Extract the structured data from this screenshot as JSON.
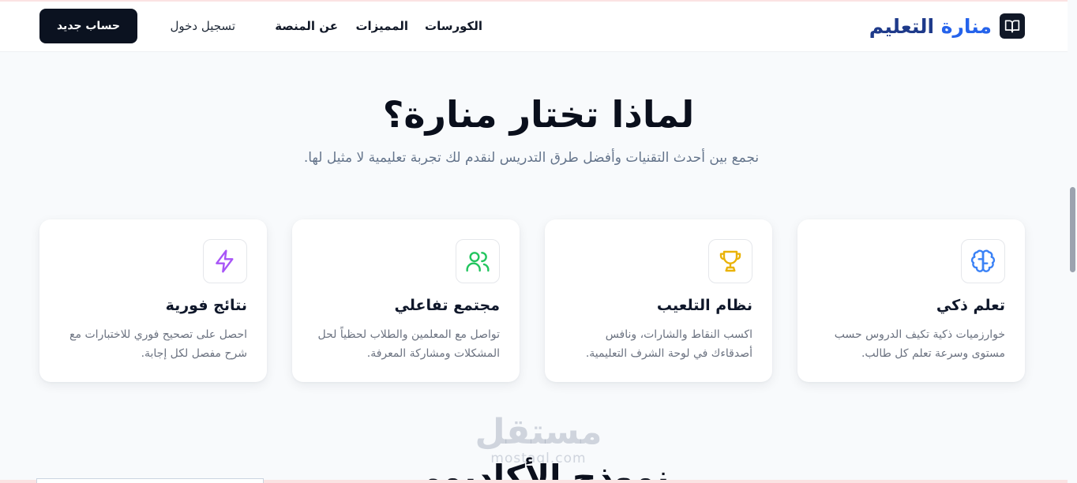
{
  "brand": {
    "name_part1": "منارة",
    "name_part2": "التعليم",
    "icon": "book-open-icon"
  },
  "nav": {
    "items": [
      {
        "label": "الكورسات"
      },
      {
        "label": "المميزات"
      },
      {
        "label": "عن المنصة"
      }
    ],
    "login_label": "تسجيل دخول",
    "signup_label": "حساب جديد"
  },
  "hero": {
    "title": "لماذا تختار منارة؟",
    "subtitle": "نجمع بين أحدث التقنيات وأفضل طرق التدريس لنقدم لك تجربة تعليمية لا مثيل لها."
  },
  "features": [
    {
      "icon": "brain-icon",
      "color": "#3b82f6",
      "title": "تعلم ذكي",
      "desc": "خوارزميات ذكية تكيف الدروس حسب مستوى وسرعة تعلم كل طالب."
    },
    {
      "icon": "trophy-icon",
      "color": "#eab308",
      "title": "نظام التلعيب",
      "desc": "اكسب النقاط والشارات، ونافس أصدقاءك في لوحة الشرف التعليمية."
    },
    {
      "icon": "users-icon",
      "color": "#22c55e",
      "title": "مجتمع تفاعلي",
      "desc": "تواصل مع المعلمين والطلاب لحظياً لحل المشكلات ومشاركة المعرفة."
    },
    {
      "icon": "zap-icon",
      "color": "#a855f7",
      "title": "نتائج فورية",
      "desc": "احصل على تصحيح فوري للاختبارات مع شرح مفصل لكل إجابة."
    }
  ],
  "watermark": {
    "main": "مستقل",
    "sub": "mostaql.com"
  },
  "next_section": {
    "title": "نموذج الأكاديمي"
  }
}
